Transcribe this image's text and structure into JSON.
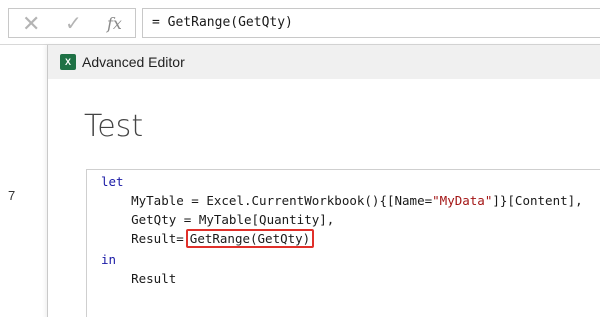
{
  "formula_bar": {
    "cancel_glyph": "✕",
    "enter_glyph": "✓",
    "function_glyph": "fx",
    "formula": "= GetRange(GetQty)"
  },
  "sheet": {
    "row_number": "7"
  },
  "editor": {
    "title": "Advanced Editor",
    "app_icon_label": "X",
    "query_name": "Test",
    "code": {
      "line1_keyword": "let",
      "line2_prefix": "    MyTable = Excel.CurrentWorkbook(){[Name=",
      "line2_string": "\"MyData\"",
      "line2_suffix": "]}[Content],",
      "line3": "    GetQty = MyTable[Quantity],",
      "line4_prefix": "    Result=",
      "line4_highlighted": "GetRange(GetQty)",
      "line5_keyword": "in",
      "line6": "    Result"
    }
  },
  "colors": {
    "excel_green": "#1e7145",
    "keyword_blue": "#1a1aa6",
    "string_red": "#a31515",
    "highlight_red": "#e0302a"
  }
}
